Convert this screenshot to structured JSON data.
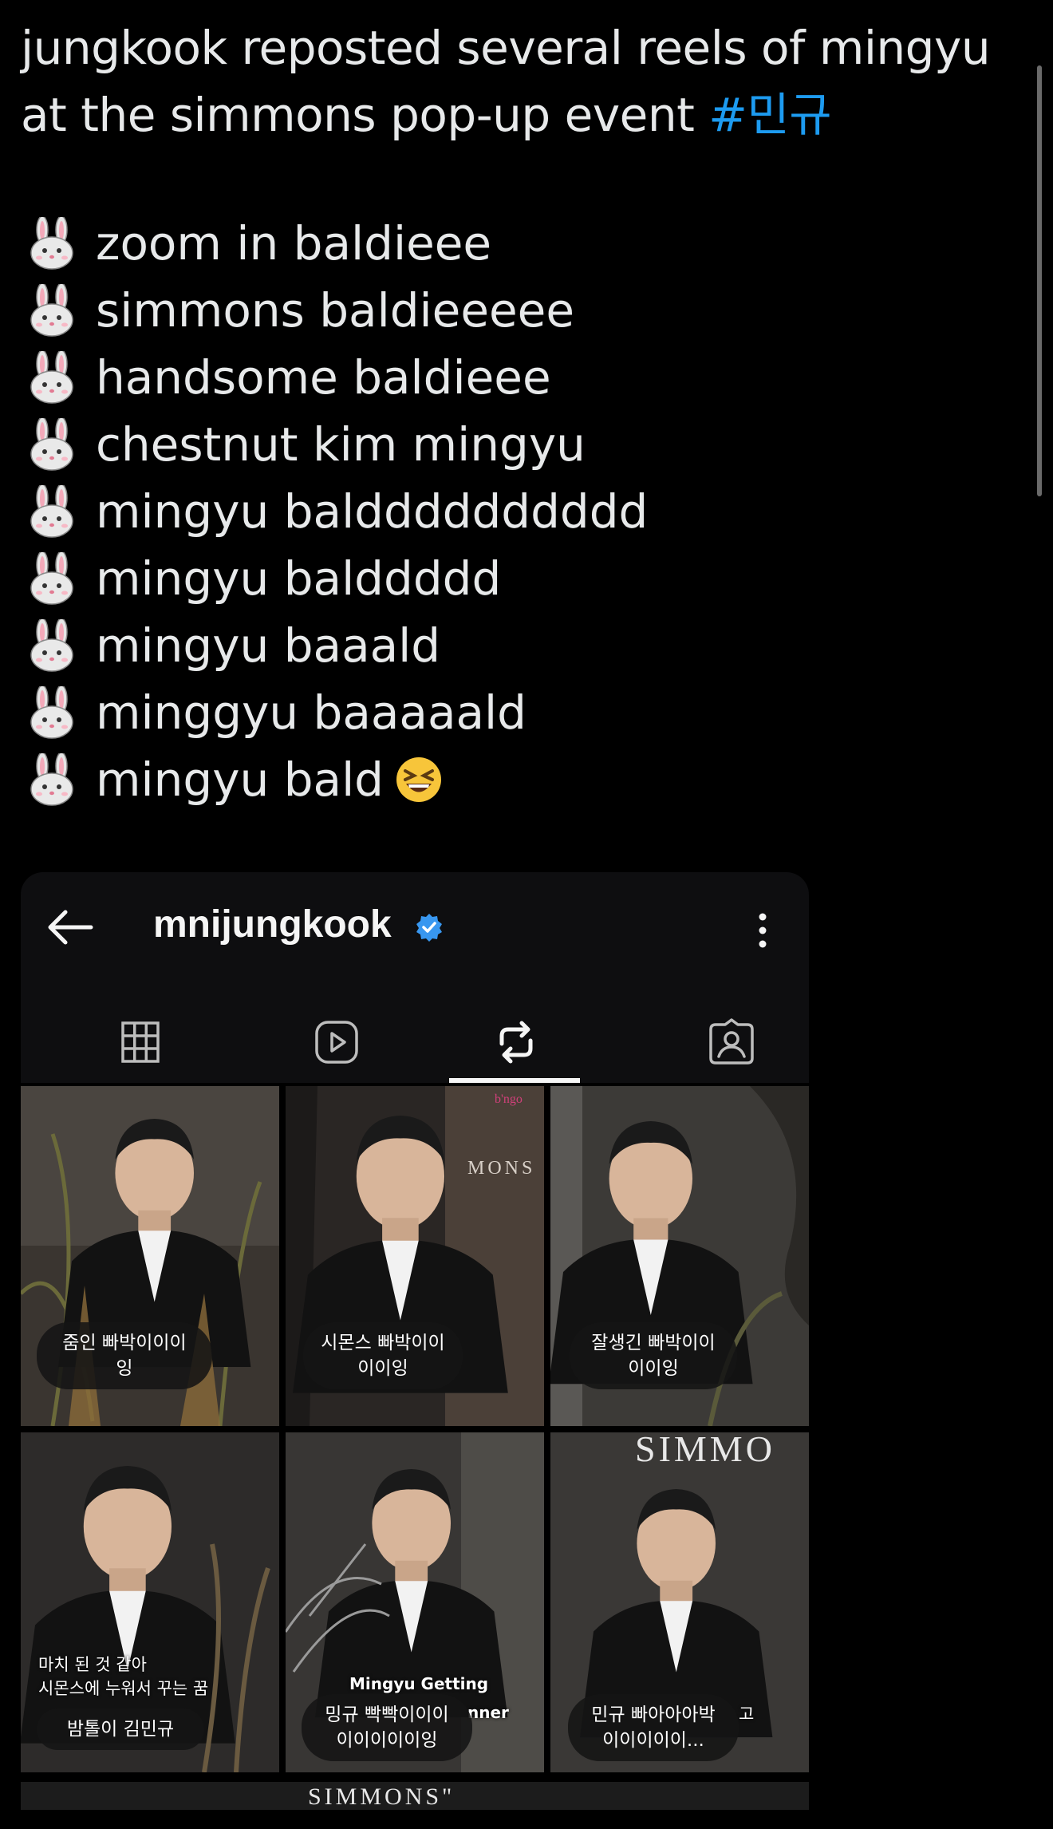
{
  "tweet": {
    "text_before_hashtag": "jungkook reposted several reels of mingyu at the simmons pop-up event ",
    "hashtag": "#민규",
    "lines": [
      "zoom in baldieee",
      "simmons baldieeeee",
      "handsome baldieee",
      "chestnut kim mingyu",
      "mingyu baldddddddddd",
      "mingyu balddddd",
      "mingyu baaald",
      "minggyu baaaaald",
      "mingyu bald"
    ],
    "bullet_icon": "rabbit-face-emoji",
    "last_line_emoji": "grinning-squinting-face-emoji"
  },
  "instagram": {
    "username": "mnijungkook",
    "verified": true,
    "tabs": [
      {
        "icon": "grid-icon",
        "active": false
      },
      {
        "icon": "reels-icon",
        "active": false
      },
      {
        "icon": "repost-icon",
        "active": true
      },
      {
        "icon": "tagged-icon",
        "active": false
      }
    ],
    "tiles": [
      {
        "caption": "줌인 빠박이이이\n잉",
        "extra": []
      },
      {
        "caption": "시몬스 빠박이이\n이이잉",
        "extra": [],
        "sign": "MONS",
        "logo": "b'ngo"
      },
      {
        "caption": "잘생긴 빠박이이\n이이잉",
        "extra": []
      },
      {
        "caption": "밤톨이 김민규",
        "extra": [
          "마치 된 것 같아",
          "시몬스에 누워서 꾸는 꿈"
        ]
      },
      {
        "caption": "밍규 빡빡이이이\n이이이이이잉",
        "extra": [
          "Mingyu Getting",
          "nner"
        ]
      },
      {
        "caption": "민규 빠아아아박\n이이이이이...",
        "extra": [
          "고"
        ],
        "sign": "SIMMO"
      }
    ],
    "bottom_sign": "SIMMONS\""
  }
}
